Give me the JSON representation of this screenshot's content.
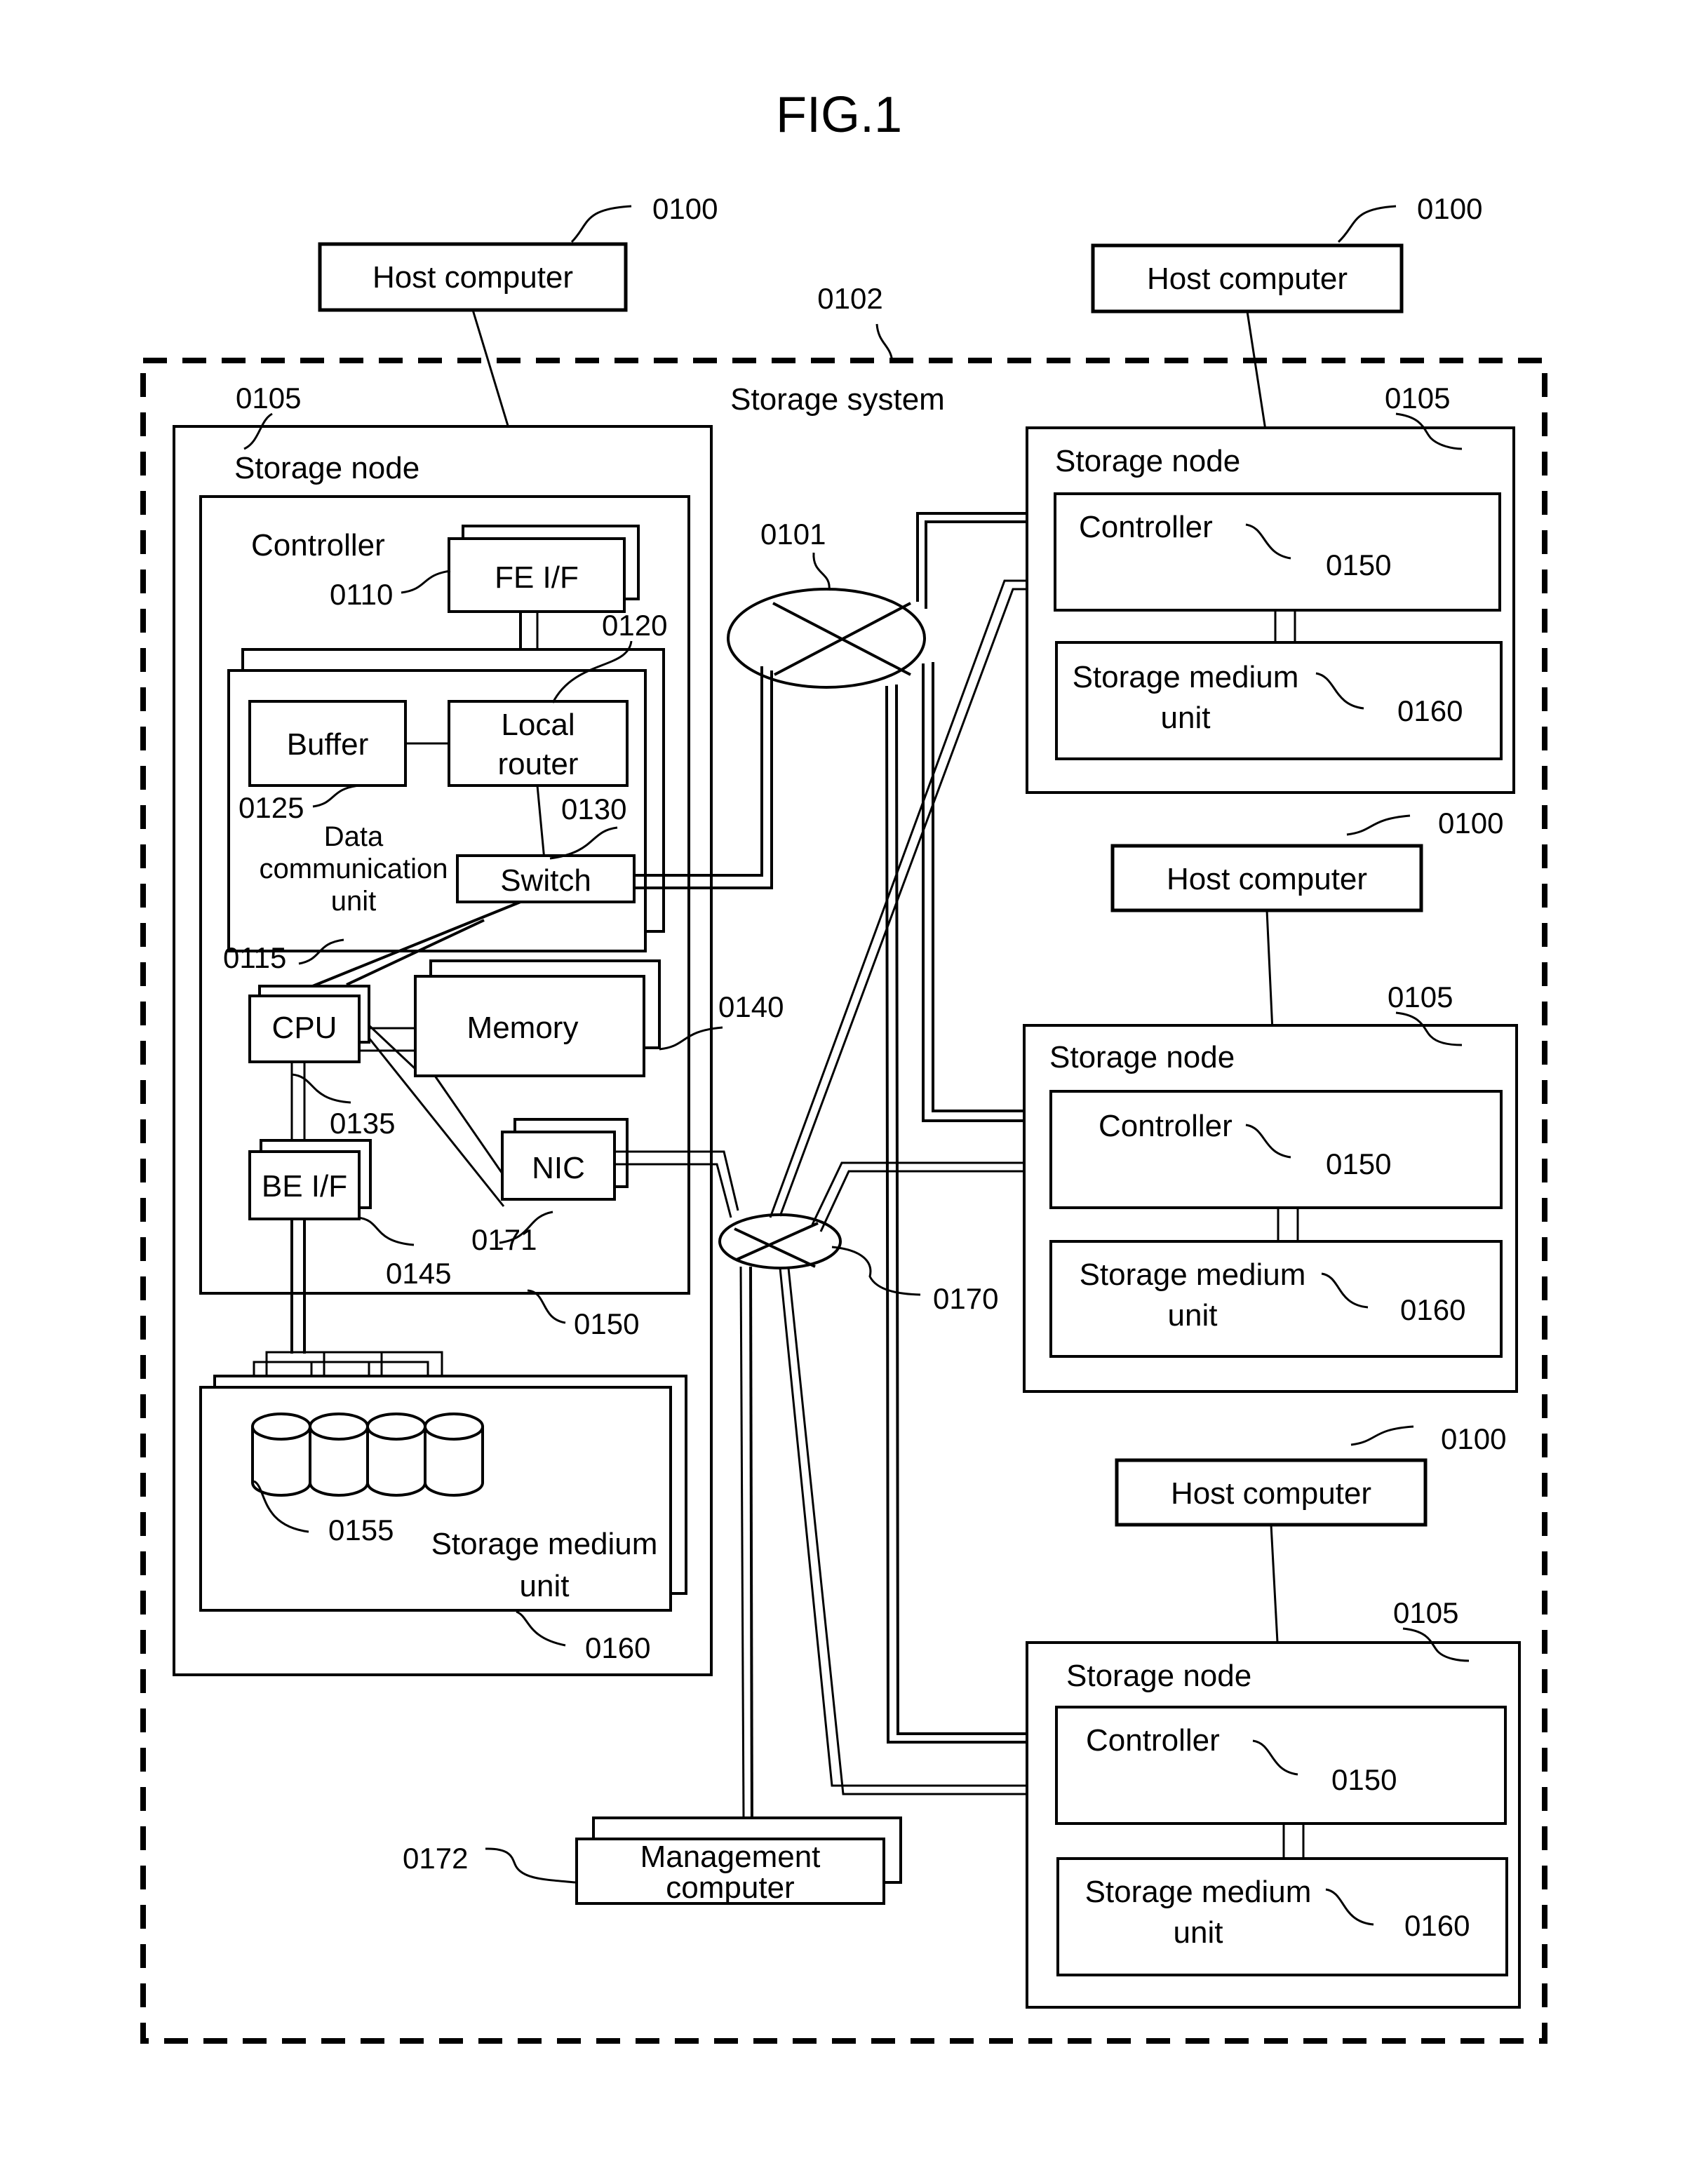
{
  "figure": {
    "title": "FIG.1",
    "storage_system": {
      "label": "Storage system",
      "ref": "0102"
    },
    "network_main": {
      "ref": "0101"
    },
    "network_mgmt": {
      "ref": "0170"
    },
    "management_computer": {
      "line1": "Management",
      "line2": "computer",
      "ref": "0172"
    },
    "host_computers": [
      {
        "label": "Host computer",
        "ref": "0100"
      },
      {
        "label": "Host computer",
        "ref": "0100"
      },
      {
        "label": "Host computer",
        "ref": "0100"
      },
      {
        "label": "Host computer",
        "ref": "0100"
      }
    ],
    "detailed_node": {
      "label": "Storage node",
      "ref": "0105",
      "controller": {
        "label": "Controller",
        "ref": "0150"
      },
      "fe_if": {
        "label": "FE I/F",
        "ref": "0110"
      },
      "data_comm_unit": {
        "line1": "Data",
        "line2": "communication",
        "line3": "unit",
        "ref": "0115"
      },
      "local_router": {
        "line1": "Local",
        "line2": "router",
        "ref": "0120"
      },
      "buffer": {
        "label": "Buffer",
        "ref": "0125"
      },
      "switch": {
        "label": "Switch",
        "ref": "0130"
      },
      "cpu": {
        "label": "CPU",
        "ref": "0135"
      },
      "memory": {
        "label": "Memory",
        "ref": "0140"
      },
      "be_if": {
        "label": "BE I/F",
        "ref": "0145"
      },
      "nic": {
        "label": "NIC",
        "ref": "0171"
      },
      "drives": {
        "ref": "0155",
        "count": 4
      },
      "storage_medium_unit": {
        "line1": "Storage medium",
        "line2": "unit",
        "ref": "0160"
      }
    },
    "simple_nodes": [
      {
        "label": "Storage node",
        "ref": "0105",
        "controller": "Controller",
        "controller_ref": "0150",
        "smu_line1": "Storage medium",
        "smu_line2": "unit",
        "smu_ref": "0160"
      },
      {
        "label": "Storage node",
        "ref": "0105",
        "controller": "Controller",
        "controller_ref": "0150",
        "smu_line1": "Storage medium",
        "smu_line2": "unit",
        "smu_ref": "0160"
      },
      {
        "label": "Storage node",
        "ref": "0105",
        "controller": "Controller",
        "controller_ref": "0150",
        "smu_line1": "Storage medium",
        "smu_line2": "unit",
        "smu_ref": "0160"
      }
    ]
  }
}
